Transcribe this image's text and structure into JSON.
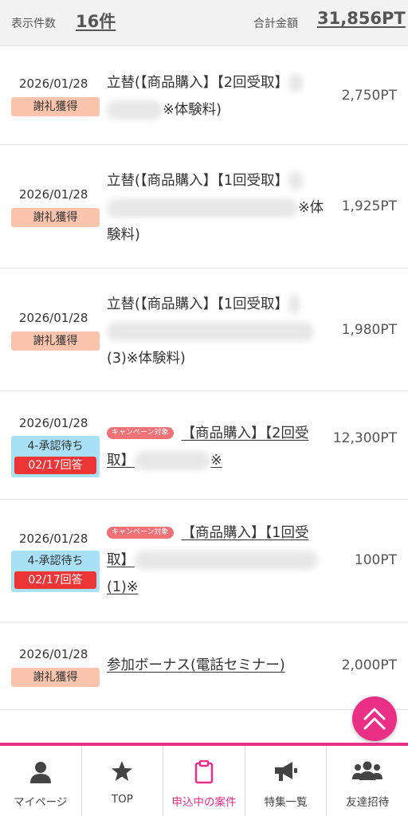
{
  "summary": {
    "count_label": "表示件数",
    "count_value": "16件",
    "total_label": "合計金額",
    "total_value": "31,856PT"
  },
  "rows": [
    {
      "date": "2026/01/28",
      "badge": "謝礼獲得",
      "title_a": "立替(【商品購入】【2回受取】",
      "title_b": "※体験料)",
      "points": "2,750PT"
    },
    {
      "date": "2026/01/28",
      "badge": "謝礼獲得",
      "title_a": "立替(【商品購入】【1回受取】",
      "title_b": "※体",
      "title_c": "験料)",
      "points": "1,925PT"
    },
    {
      "date": "2026/01/28",
      "badge": "謝礼獲得",
      "title_a": "立替(【商品購入】【1回受取】",
      "title_c": "(3)※体験料)",
      "points": "1,980PT"
    },
    {
      "date": "2026/01/28",
      "status": "4-承認待ち",
      "answer": "02/17回答",
      "campaign": "キャンペーン対象",
      "title_a": "【商品購入】【2回受",
      "title_b": "取】",
      "title_c": "※",
      "points": "12,300PT"
    },
    {
      "date": "2026/01/28",
      "status": "4-承認待ち",
      "answer": "02/17回答",
      "campaign": "キャンペーン対象",
      "title_a": "【商品購入】【1回受",
      "title_b": "取】",
      "title_c": "(1)※",
      "points": "100PT"
    },
    {
      "date": "2026/01/28",
      "badge": "謝礼獲得",
      "title_a": "参加ボーナス(電話セミナー)",
      "points": "2,000PT"
    }
  ],
  "nav": [
    {
      "label": "マイページ",
      "icon": "person-icon"
    },
    {
      "label": "TOP",
      "icon": "star-icon"
    },
    {
      "label": "申込中の案件",
      "icon": "clipboard-icon"
    },
    {
      "label": "特集一覧",
      "icon": "megaphone-icon"
    },
    {
      "label": "友達招待",
      "icon": "group-icon"
    }
  ],
  "colors": {
    "accent": "#ea2f87",
    "reward_badge": "#fcc4ad",
    "status_badge": "#a8e1f5",
    "answer_badge": "#ee3535"
  }
}
